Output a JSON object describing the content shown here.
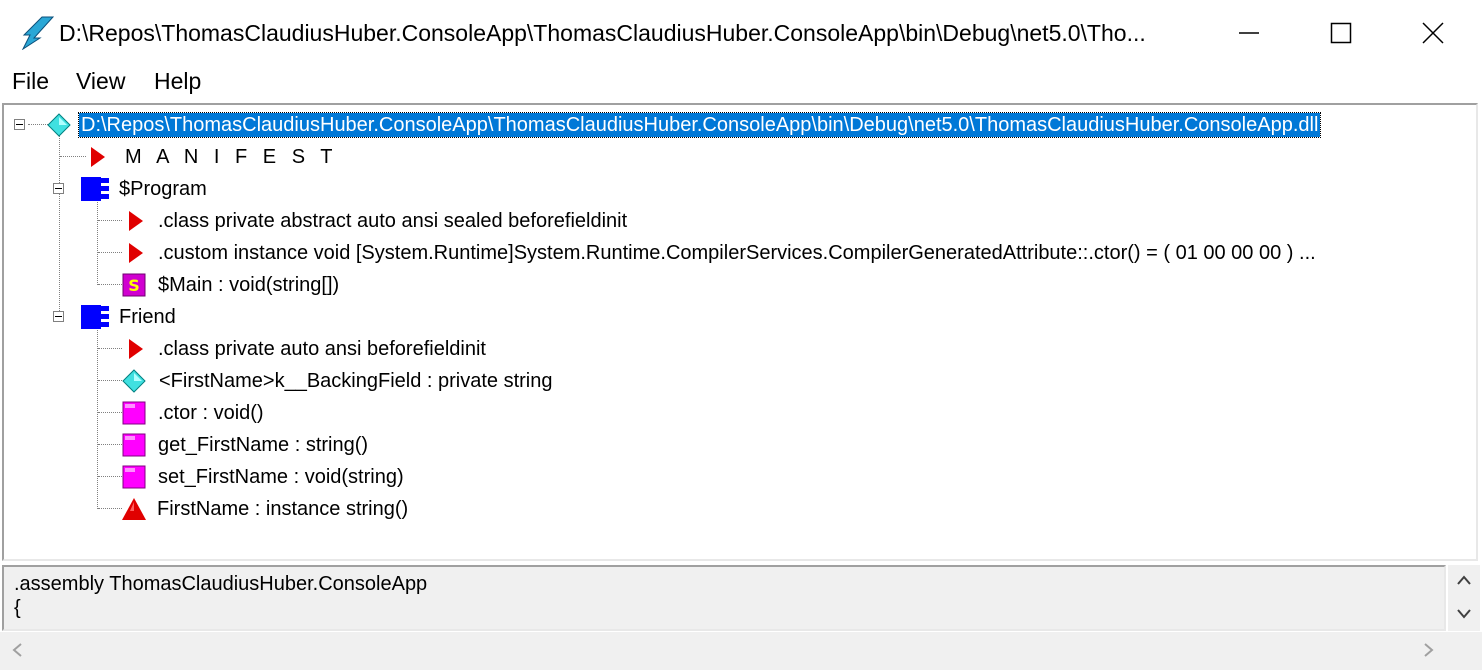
{
  "window": {
    "title": "D:\\Repos\\ThomasClaudiusHuber.ConsoleApp\\ThomasClaudiusHuber.ConsoleApp\\bin\\Debug\\net5.0\\Tho...",
    "icon": "ildasm-lightning-icon"
  },
  "menu": {
    "file": "File",
    "view": "View",
    "help": "Help"
  },
  "tree": {
    "root": "D:\\Repos\\ThomasClaudiusHuber.ConsoleApp\\ThomasClaudiusHuber.ConsoleApp\\bin\\Debug\\net5.0\\ThomasClaudiusHuber.ConsoleApp.dll",
    "manifest": "M A N I F E S T",
    "program": {
      "name": "$Program",
      "class_decl": ".class private abstract auto ansi sealed beforefieldinit",
      "custom_attr": ".custom instance void [System.Runtime]System.Runtime.CompilerServices.CompilerGeneratedAttribute::.ctor() = ( 01 00 00 00 )  ...",
      "main": "$Main : void(string[])"
    },
    "friend": {
      "name": "Friend",
      "class_decl": ".class private auto ansi beforefieldinit",
      "field": "<FirstName>k__BackingField : private string",
      "ctor": ".ctor : void()",
      "getter": "get_FirstName : string()",
      "setter": "set_FirstName : void(string)",
      "property": "FirstName : instance string()"
    }
  },
  "code": {
    "line1": ".assembly ThomasClaudiusHuber.ConsoleApp",
    "line2": "{"
  },
  "colors": {
    "selection": "#0078d7",
    "class_blue": "#0000ff",
    "method_magenta": "#ff00ff",
    "marker_red": "#e00000",
    "field_cyan": "#40e0e0"
  }
}
